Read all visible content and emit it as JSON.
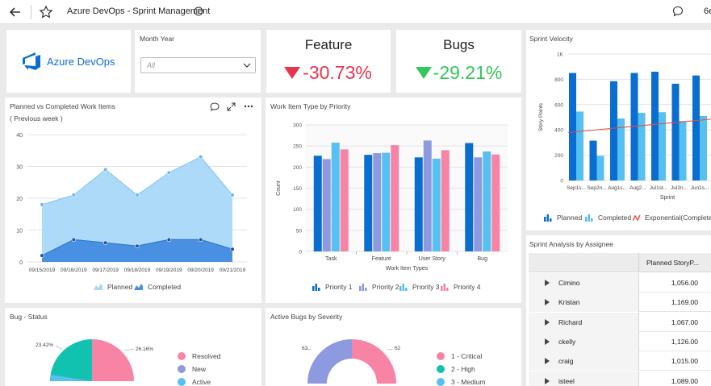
{
  "header": {
    "title": "Azure DevOps - Sprint Management",
    "cut_text": "6e"
  },
  "logo": {
    "text": "Azure DevOps"
  },
  "filter": {
    "label": "Month Year",
    "placeholder": "All"
  },
  "kpis": [
    {
      "label": "Feature",
      "value": "-30.73%",
      "direction": "down",
      "color": "#e8344d"
    },
    {
      "label": "Bugs",
      "value": "-29.21%",
      "direction": "down",
      "color": "#34c759"
    }
  ],
  "planned_vs_completed": {
    "title": "Planned vs Completed Work Items",
    "subtitle": "( Previous week )",
    "legend": [
      "Planned",
      "Completed"
    ],
    "chart_data": {
      "type": "area",
      "categories": [
        "09/15/2019",
        "09/16/2019",
        "09/17/2019",
        "09/18/2019",
        "09/19/2019",
        "09/20/2019",
        "09/21/2019"
      ],
      "series": [
        {
          "name": "Planned",
          "values": [
            18,
            21,
            29,
            21,
            28,
            33,
            21
          ]
        },
        {
          "name": "Completed",
          "values": [
            2,
            7,
            6,
            5,
            7,
            7,
            4
          ]
        }
      ],
      "yticks": [
        0,
        10,
        20,
        30,
        40
      ],
      "ylim": [
        0,
        40
      ],
      "colors": [
        "#a8d8f8",
        "#4a90e2"
      ]
    }
  },
  "work_item_type": {
    "title": "Work Item Type by Priority",
    "legend": [
      "Priority 1",
      "Priority 2",
      "Priority 3",
      "Priority 4"
    ],
    "chart_data": {
      "type": "bar",
      "categories": [
        "Task",
        "Feature",
        "User Story",
        "Bug"
      ],
      "series": [
        {
          "name": "Priority 1",
          "values": [
            227,
            229,
            223,
            257
          ]
        },
        {
          "name": "Priority 2",
          "values": [
            219,
            233,
            263,
            223
          ]
        },
        {
          "name": "Priority 3",
          "values": [
            258,
            234,
            220,
            237
          ]
        },
        {
          "name": "Priority 4",
          "values": [
            242,
            252,
            240,
            230
          ]
        }
      ],
      "xlabel": "Work Item Types",
      "ylabel": "Count",
      "yticks": [
        0,
        50,
        100,
        150,
        200,
        250,
        300
      ],
      "ylim": [
        0,
        300
      ],
      "colors": [
        "#0a6ed1",
        "#8e9ae0",
        "#56c0f0",
        "#f783a5"
      ]
    }
  },
  "sprint_velocity": {
    "title": "Sprint Velocity",
    "legend": [
      "Planned",
      "Completed",
      "Exponential(Completed"
    ],
    "chart_data": {
      "type": "bar",
      "categories": [
        "Sep1s...",
        "Sep2n...",
        "Aug1s...",
        "Aug2...",
        "Jul1st...",
        "Jul2n...",
        "Jun1s..."
      ],
      "series": [
        {
          "name": "Planned",
          "values": [
            850,
            315,
            785,
            850,
            860,
            765,
            830
          ]
        },
        {
          "name": "Completed",
          "values": [
            545,
            195,
            490,
            535,
            540,
            470,
            510
          ]
        }
      ],
      "xlabel": "Sprint",
      "ylabel": "Story Points",
      "ytick_labels": [
        "0",
        "200",
        "400",
        "600",
        "800",
        "1K"
      ],
      "ylim": [
        0,
        1000
      ],
      "colors": [
        "#0a6ed1",
        "#56c0f0",
        "#e84a3c"
      ]
    }
  },
  "assignee": {
    "title": "Sprint Analysis by Assignee",
    "column": "Planned StoryP...",
    "rows": [
      {
        "name": "Cimino",
        "value": "1,056.00"
      },
      {
        "name": "Kristan",
        "value": "1,169.00"
      },
      {
        "name": "Richard",
        "value": "1,067.00"
      },
      {
        "name": "ckelly",
        "value": "1,126.00"
      },
      {
        "name": "craig",
        "value": "1,015.00"
      },
      {
        "name": "isteel",
        "value": "1,089.00"
      }
    ]
  },
  "bug_status": {
    "title": "Bug - Status",
    "labels": [
      "23.42%",
      "26.16%"
    ],
    "legend": [
      "Resolved",
      "New",
      "Active"
    ],
    "colors": [
      "#f783a5",
      "#8e9ae0",
      "#56c0f0",
      "#12c2b0"
    ]
  },
  "active_bugs": {
    "title": "Active Bugs by Severity",
    "labels": [
      "63",
      "62"
    ],
    "legend": [
      "1 - Critical",
      "2 - High",
      "3 - Medium"
    ],
    "colors": [
      "#f783a5",
      "#12c2b0",
      "#56c0f0",
      "#8e9ae0"
    ]
  }
}
